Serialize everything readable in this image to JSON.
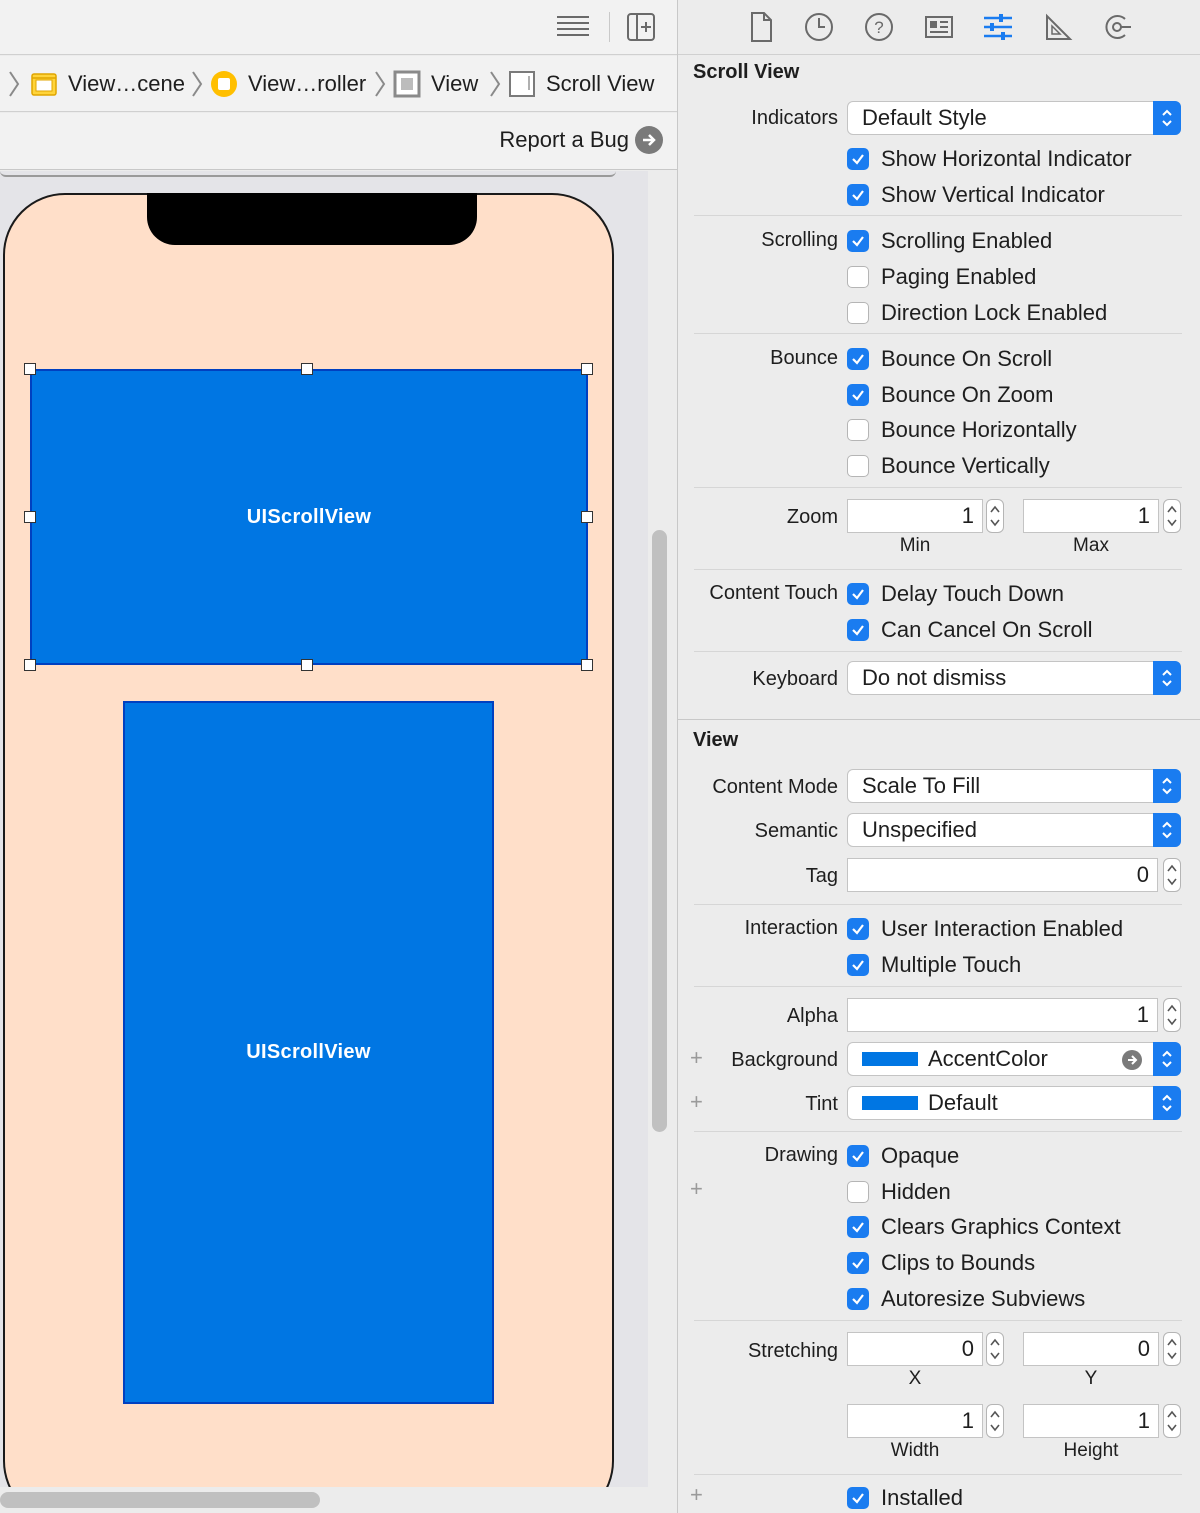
{
  "breadcrumb": {
    "items": [
      {
        "label": "View…cene",
        "icon": "scene-icon"
      },
      {
        "label": "View…roller",
        "icon": "view-controller-icon"
      },
      {
        "label": "View",
        "icon": "view-icon"
      },
      {
        "label": "Scroll View",
        "icon": "scroll-view-icon"
      }
    ]
  },
  "report_bug": {
    "label": "Report a Bug"
  },
  "canvas": {
    "scroll_view_1": "UIScrollView",
    "scroll_view_2": "UIScrollView",
    "colors": {
      "phone_bg": "#ffdfc9",
      "scroll_bg": "#0076e3",
      "accent": "#1a7cf0"
    }
  },
  "inspector": {
    "tabs": [
      "file-icon",
      "history-icon",
      "help-icon",
      "identity-icon",
      "attributes-icon",
      "size-icon",
      "connections-icon"
    ],
    "scroll_view": {
      "title": "Scroll View",
      "indicators": {
        "label": "Indicators",
        "value": "Default Style",
        "show_horizontal": {
          "label": "Show Horizontal Indicator",
          "checked": true
        },
        "show_vertical": {
          "label": "Show Vertical Indicator",
          "checked": true
        }
      },
      "scrolling": {
        "label": "Scrolling",
        "enabled": {
          "label": "Scrolling Enabled",
          "checked": true
        },
        "paging": {
          "label": "Paging Enabled",
          "checked": false
        },
        "direction_lock": {
          "label": "Direction Lock Enabled",
          "checked": false
        }
      },
      "bounce": {
        "label": "Bounce",
        "on_scroll": {
          "label": "Bounce On Scroll",
          "checked": true
        },
        "on_zoom": {
          "label": "Bounce On Zoom",
          "checked": true
        },
        "horizontally": {
          "label": "Bounce Horizontally",
          "checked": false
        },
        "vertically": {
          "label": "Bounce Vertically",
          "checked": false
        }
      },
      "zoom": {
        "label": "Zoom",
        "min_value": "1",
        "max_value": "1",
        "min_label": "Min",
        "max_label": "Max"
      },
      "content_touch": {
        "label": "Content Touch",
        "delay": {
          "label": "Delay Touch Down",
          "checked": true
        },
        "cancel": {
          "label": "Can Cancel On Scroll",
          "checked": true
        }
      },
      "keyboard": {
        "label": "Keyboard",
        "value": "Do not dismiss"
      }
    },
    "view": {
      "title": "View",
      "content_mode": {
        "label": "Content Mode",
        "value": "Scale To Fill"
      },
      "semantic": {
        "label": "Semantic",
        "value": "Unspecified"
      },
      "tag": {
        "label": "Tag",
        "value": "0"
      },
      "interaction": {
        "label": "Interaction",
        "user_interaction": {
          "label": "User Interaction Enabled",
          "checked": true
        },
        "multiple_touch": {
          "label": "Multiple Touch",
          "checked": true
        }
      },
      "alpha": {
        "label": "Alpha",
        "value": "1"
      },
      "background": {
        "label": "Background",
        "value": "AccentColor"
      },
      "tint": {
        "label": "Tint",
        "value": "Default"
      },
      "drawing": {
        "label": "Drawing",
        "opaque": {
          "label": "Opaque",
          "checked": true
        },
        "hidden": {
          "label": "Hidden",
          "checked": false
        },
        "clears": {
          "label": "Clears Graphics Context",
          "checked": true
        },
        "clips": {
          "label": "Clips to Bounds",
          "checked": true
        },
        "autoresize": {
          "label": "Autoresize Subviews",
          "checked": true
        }
      },
      "stretching": {
        "label": "Stretching",
        "x": "0",
        "y": "0",
        "width": "1",
        "height": "1",
        "x_label": "X",
        "y_label": "Y",
        "width_label": "Width",
        "height_label": "Height"
      },
      "installed": {
        "label": "Installed",
        "checked": true
      }
    }
  }
}
